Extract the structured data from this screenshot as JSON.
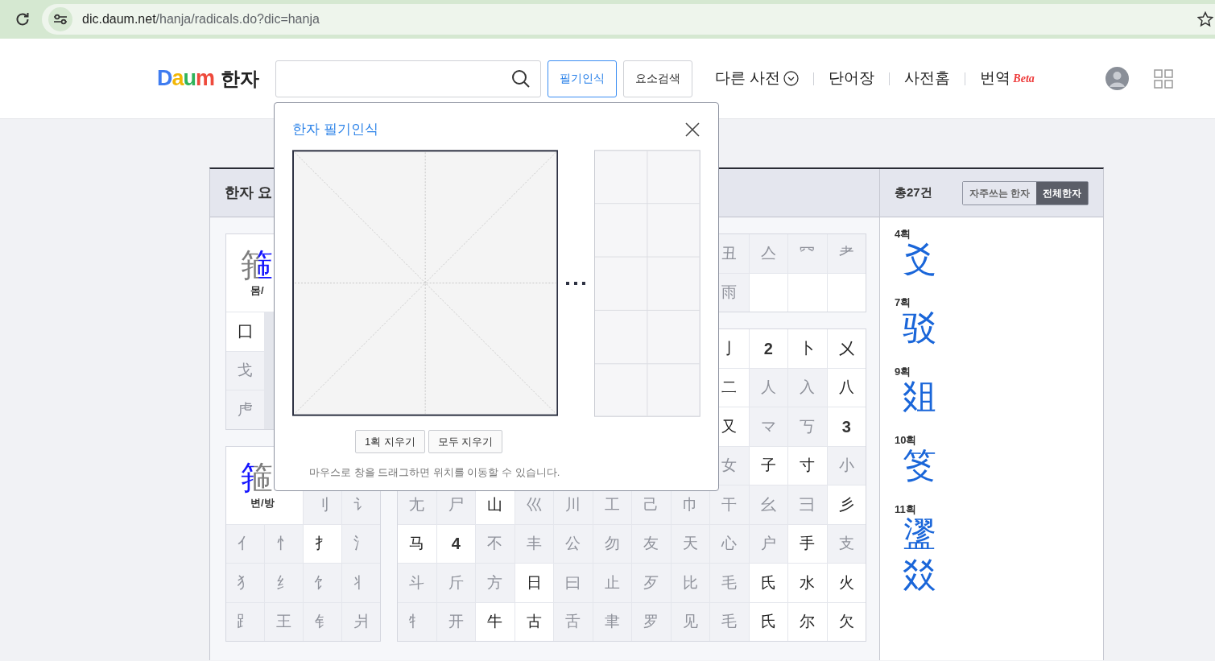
{
  "browser": {
    "url_domain": "dic.daum.net",
    "url_path": "/hanja/radicals.do?dic=hanja"
  },
  "header": {
    "logo": [
      {
        "letter": "D",
        "color": "#3f7cf0"
      },
      {
        "letter": "a",
        "color": "#f2b705"
      },
      {
        "letter": "u",
        "color": "#2fb35a"
      },
      {
        "letter": "m",
        "color": "#ee4a3c"
      }
    ],
    "section": "한자",
    "buttons": [
      {
        "label": "필기인식",
        "selected": true
      },
      {
        "label": "요소검색",
        "selected": false
      }
    ],
    "nav": [
      {
        "label": "다른 사전",
        "kind": "dropdown"
      },
      {
        "label": "단어장",
        "kind": "link"
      },
      {
        "label": "사전홈",
        "kind": "link"
      },
      {
        "label": "번역",
        "kind": "beta",
        "badge": "Beta"
      }
    ]
  },
  "radical_panel": {
    "title": "한자 요",
    "side_groups": [
      {
        "kind": "wide",
        "glyph": "箍",
        "label": "몸/",
        "rows": [
          {
            "cells": [
              {
                "char": "囗",
                "active": true
              }
            ]
          },
          {
            "cells": [
              {
                "char": "戈",
                "active": false
              }
            ]
          },
          {
            "cells": [
              {
                "char": "虍",
                "active": false
              }
            ]
          }
        ]
      },
      {
        "kind": "corner",
        "glyph": "箍",
        "label": "변/방",
        "rows": [
          {
            "cells": [
              {
                "kind": "header_span"
              },
              {
                "kind": "header_span"
              },
              {
                "char": "刂",
                "active": false
              },
              {
                "char": "讠",
                "active": false
              }
            ]
          },
          {
            "cells": [
              {
                "char": "亻",
                "active": false
              },
              {
                "char": "忄",
                "active": false
              },
              {
                "char": "扌",
                "active": true
              },
              {
                "char": "氵",
                "active": false
              }
            ]
          },
          {
            "cells": [
              {
                "char": "犭",
                "active": false
              },
              {
                "char": "纟",
                "active": false
              },
              {
                "char": "饣",
                "active": false
              },
              {
                "char": "丬",
                "active": false
              }
            ]
          },
          {
            "cells": [
              {
                "char": "⻊",
                "active": false
              },
              {
                "char": "王",
                "active": false
              },
              {
                "char": "钅",
                "active": false
              },
              {
                "char": "爿",
                "active": false
              }
            ]
          }
        ]
      }
    ],
    "stroke_blocks": [
      {
        "rows": [
          {
            "cells": [
              {
                "char": "丑",
                "active": false
              },
              {
                "char": "亼",
                "active": false
              },
              {
                "char": "⺳",
                "active": false
              },
              {
                "char": "⺹",
                "active": false
              }
            ]
          },
          {
            "cells": [
              {
                "char": "雨",
                "active": false
              },
              {
                "kind": "blank"
              },
              {
                "kind": "blank"
              },
              {
                "kind": "blank"
              }
            ]
          }
        ]
      },
      {
        "rows": [
          {
            "cells": [
              {
                "char": "亅",
                "active": true
              },
              {
                "kind": "count",
                "char": "2"
              },
              {
                "char": "卜",
                "active": true
              },
              {
                "char": "㐅",
                "active": true
              }
            ]
          },
          {
            "cells": [
              {
                "char": "二",
                "active": true
              },
              {
                "char": "人",
                "active": false
              },
              {
                "char": "入",
                "active": false
              },
              {
                "char": "八",
                "active": true
              }
            ]
          },
          {
            "cells": [
              {
                "char": "又",
                "active": true
              },
              {
                "char": "マ",
                "active": false
              },
              {
                "char": "丂",
                "active": false
              },
              {
                "kind": "count",
                "char": "3"
              }
            ]
          },
          {
            "cells": [
              {
                "char": "女",
                "active": false
              },
              {
                "char": "子",
                "active": true
              },
              {
                "char": "寸",
                "active": true
              },
              {
                "char": "小",
                "active": false
              }
            ]
          },
          {
            "cells": [
              {
                "char": "尢",
                "active": false
              },
              {
                "char": "尸",
                "active": false
              },
              {
                "char": "山",
                "active": true
              },
              {
                "char": "巛",
                "active": false
              },
              {
                "char": "川",
                "active": false
              },
              {
                "char": "工",
                "active": false
              },
              {
                "char": "己",
                "active": false
              },
              {
                "char": "巾",
                "active": false
              },
              {
                "char": "干",
                "active": false
              },
              {
                "char": "幺",
                "active": false
              },
              {
                "char": "彐",
                "active": false
              },
              {
                "char": "彡",
                "active": true
              }
            ]
          },
          {
            "cells": [
              {
                "char": "马",
                "active": true
              },
              {
                "kind": "count",
                "char": "4"
              },
              {
                "char": "不",
                "active": false
              },
              {
                "char": "丰",
                "active": false
              },
              {
                "char": "公",
                "active": false
              },
              {
                "char": "勿",
                "active": false
              },
              {
                "char": "友",
                "active": false
              },
              {
                "char": "天",
                "active": false
              },
              {
                "char": "心",
                "active": false
              },
              {
                "char": "户",
                "active": false
              },
              {
                "char": "手",
                "active": true
              },
              {
                "char": "支",
                "active": false
              }
            ]
          },
          {
            "cells": [
              {
                "char": "斗",
                "active": false
              },
              {
                "char": "斤",
                "active": false
              },
              {
                "char": "方",
                "active": false
              },
              {
                "char": "日",
                "active": true
              },
              {
                "char": "曰",
                "active": false
              },
              {
                "char": "止",
                "active": false
              },
              {
                "char": "歹",
                "active": false
              },
              {
                "char": "比",
                "active": false
              },
              {
                "char": "毛",
                "active": false
              },
              {
                "char": "氏",
                "active": true
              },
              {
                "char": "水",
                "active": true
              },
              {
                "char": "火",
                "active": true
              }
            ]
          },
          {
            "cells": [
              {
                "char": "牜",
                "active": false
              },
              {
                "char": "开",
                "active": false
              },
              {
                "char": "牛",
                "active": true
              },
              {
                "char": "古",
                "active": true
              },
              {
                "char": "舌",
                "active": false
              },
              {
                "char": "聿",
                "active": false
              },
              {
                "char": "罗",
                "active": false
              },
              {
                "char": "见",
                "active": false
              },
              {
                "char": "毛",
                "active": false
              },
              {
                "char": "氏",
                "active": true
              },
              {
                "char": "尔",
                "active": true
              },
              {
                "char": "欠",
                "active": true
              }
            ]
          }
        ]
      }
    ]
  },
  "results": {
    "total": "총27건",
    "filters": [
      {
        "label": "자주쓰는 한자",
        "selected": false
      },
      {
        "label": "전체한자",
        "selected": true
      }
    ],
    "groups": [
      {
        "strokes": "4획",
        "chars": [
          "爻"
        ]
      },
      {
        "strokes": "7획",
        "chars": [
          "驳"
        ]
      },
      {
        "strokes": "9획",
        "chars": [
          "爼"
        ]
      },
      {
        "strokes": "10획",
        "chars": [
          "笅"
        ]
      },
      {
        "strokes": "11획",
        "chars": [
          "䀊",
          "㸚"
        ]
      }
    ]
  },
  "popup": {
    "title": "한자 필기인식",
    "buttons": [
      "1획 지우기",
      "모두 지우기"
    ],
    "hint": "마우스로 창을 드래그하면 위치를 이동할 수 있습니다."
  }
}
